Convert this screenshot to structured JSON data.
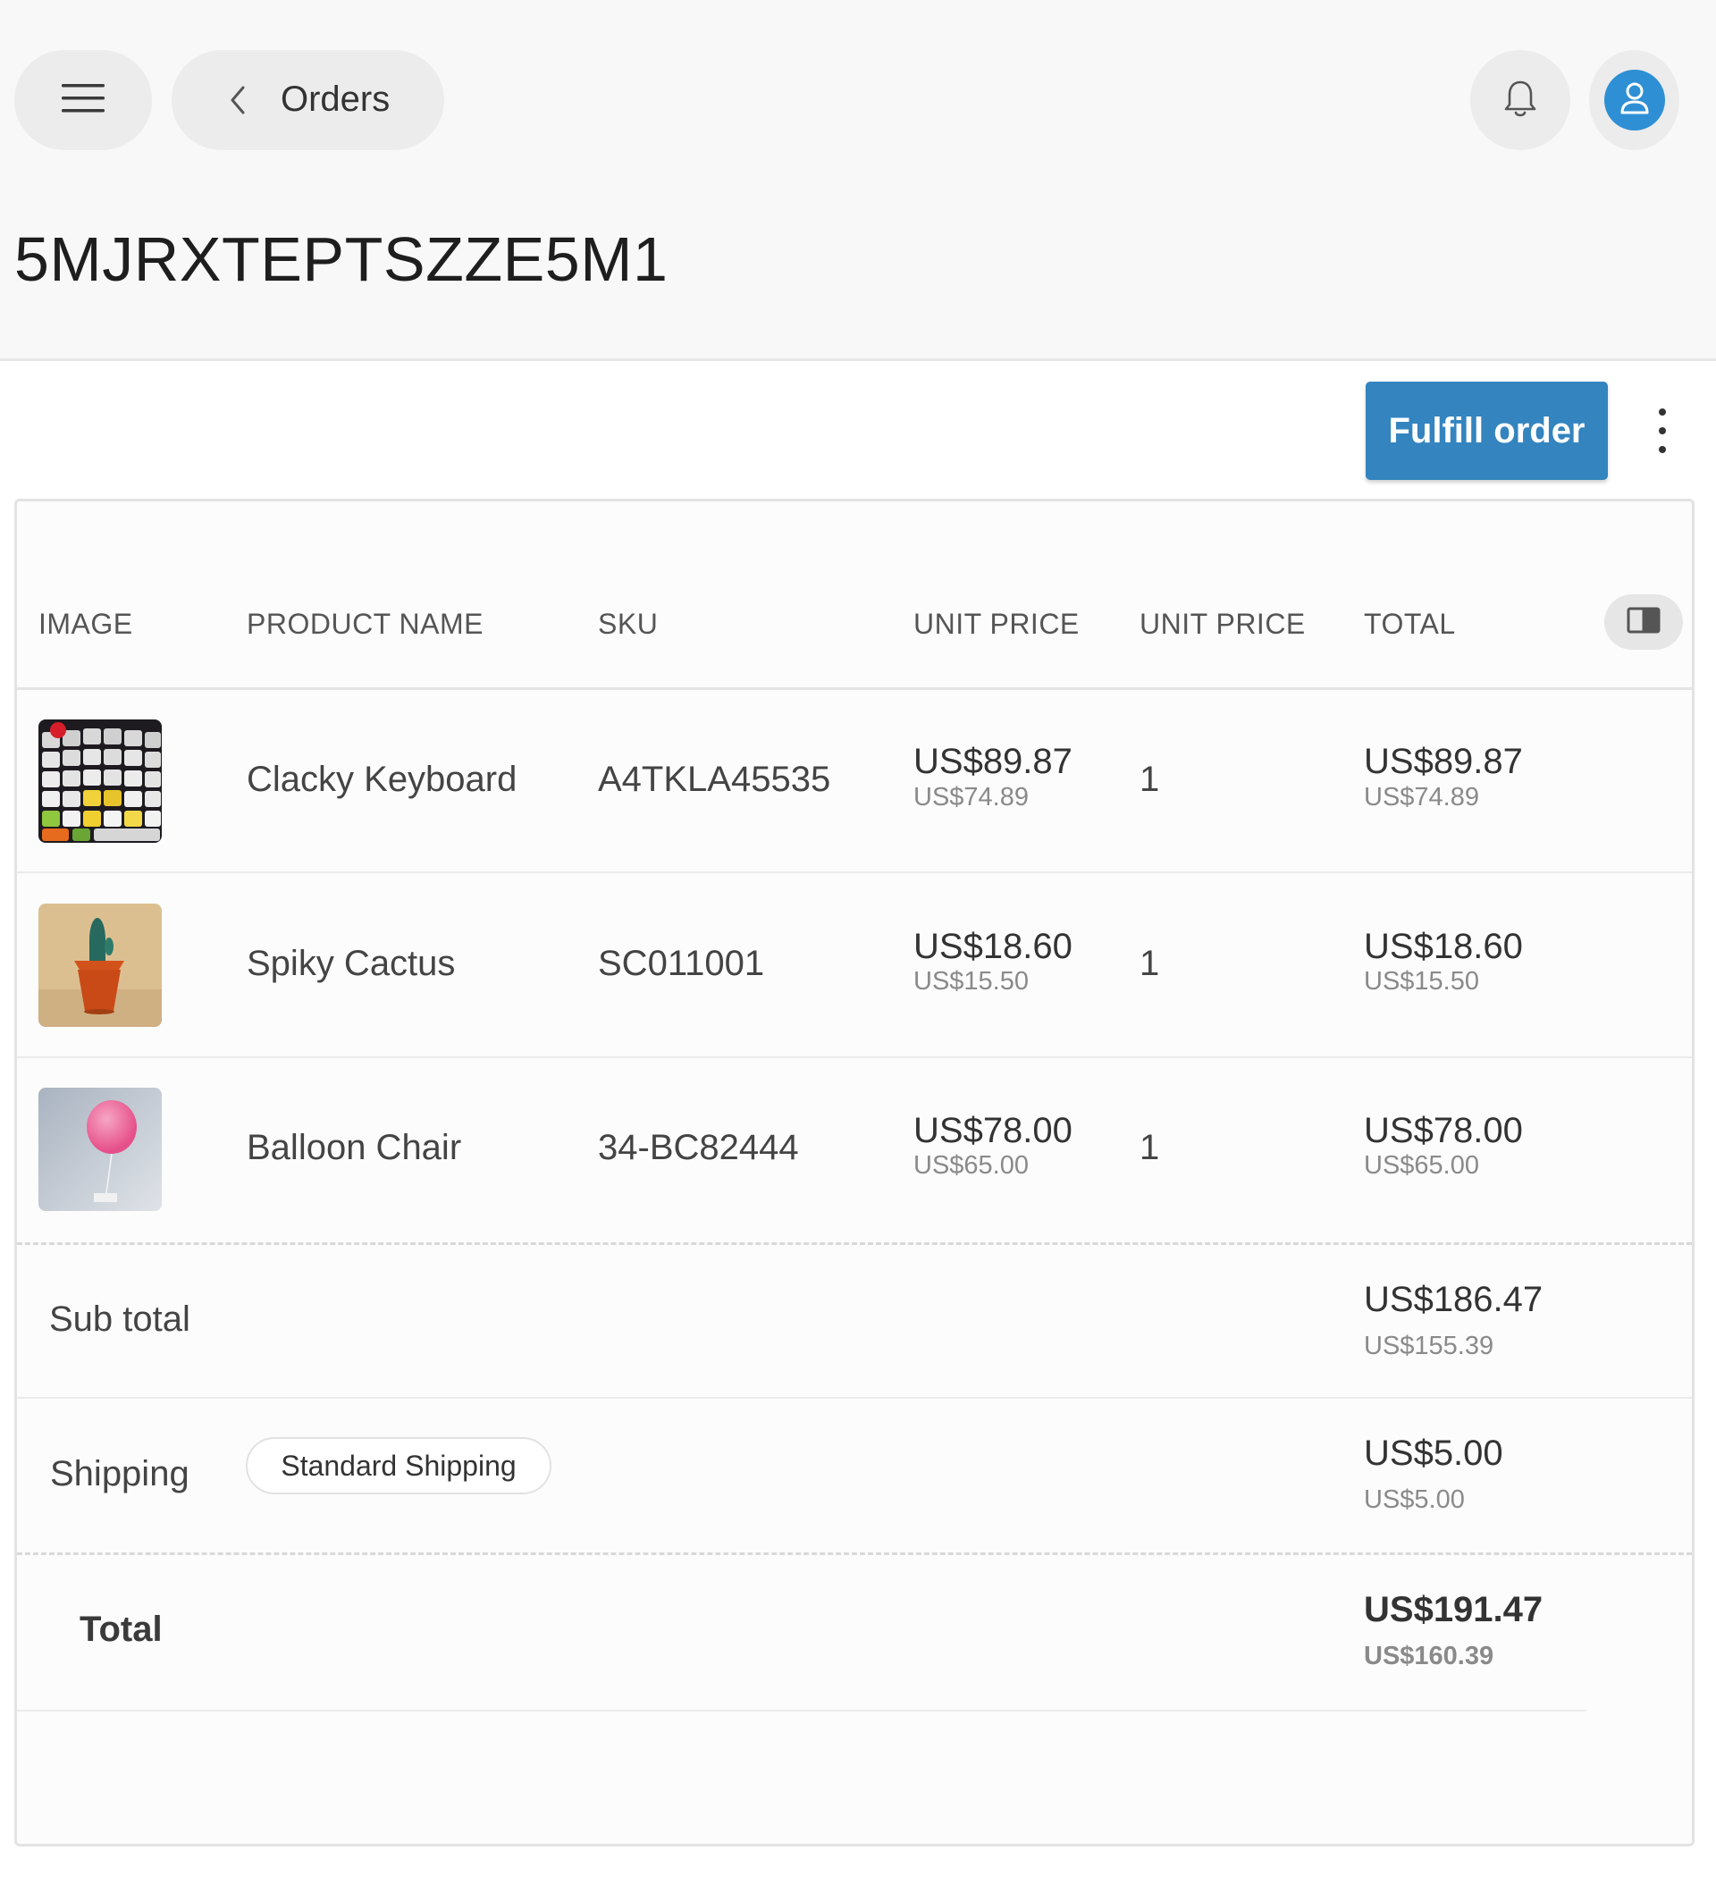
{
  "header": {
    "menu_icon": "hamburger-menu-icon",
    "back_label": "Orders",
    "notification_icon": "bell-icon",
    "account_icon": "user-avatar-icon",
    "accent_color": "#2f8fd4"
  },
  "page": {
    "title": "5MJRXTEPTSZZE5M1"
  },
  "actions": {
    "fulfill_label": "Fulfill order",
    "fulfill_color": "#3384bf",
    "more_icon": "more-vertical-icon"
  },
  "table": {
    "columns": [
      "IMAGE",
      "PRODUCT NAME",
      "SKU",
      "UNIT PRICE",
      "UNIT PRICE",
      "TOTAL"
    ],
    "column_toggle_icon": "columns-icon",
    "rows": [
      {
        "image": "keyboard-image",
        "name": "Clacky Keyboard",
        "sku": "A4TKLA45535",
        "unit_price": "US$89.87",
        "unit_price_sub": "US$74.89",
        "quantity": "1",
        "total": "US$89.87",
        "total_sub": "US$74.89"
      },
      {
        "image": "cactus-image",
        "name": "Spiky Cactus",
        "sku": "SC011001",
        "unit_price": "US$18.60",
        "unit_price_sub": "US$15.50",
        "quantity": "1",
        "total": "US$18.60",
        "total_sub": "US$15.50"
      },
      {
        "image": "balloon-chair-image",
        "name": "Balloon Chair",
        "sku": "34-BC82444",
        "unit_price": "US$78.00",
        "unit_price_sub": "US$65.00",
        "quantity": "1",
        "total": "US$78.00",
        "total_sub": "US$65.00"
      }
    ]
  },
  "summary": {
    "subtotal_label": "Sub total",
    "subtotal": "US$186.47",
    "subtotal_sub": "US$155.39",
    "shipping_label": "Shipping",
    "shipping_method": "Standard Shipping",
    "shipping": "US$5.00",
    "shipping_sub": "US$5.00",
    "total_label": "Total",
    "total": "US$191.47",
    "total_sub": "US$160.39"
  }
}
